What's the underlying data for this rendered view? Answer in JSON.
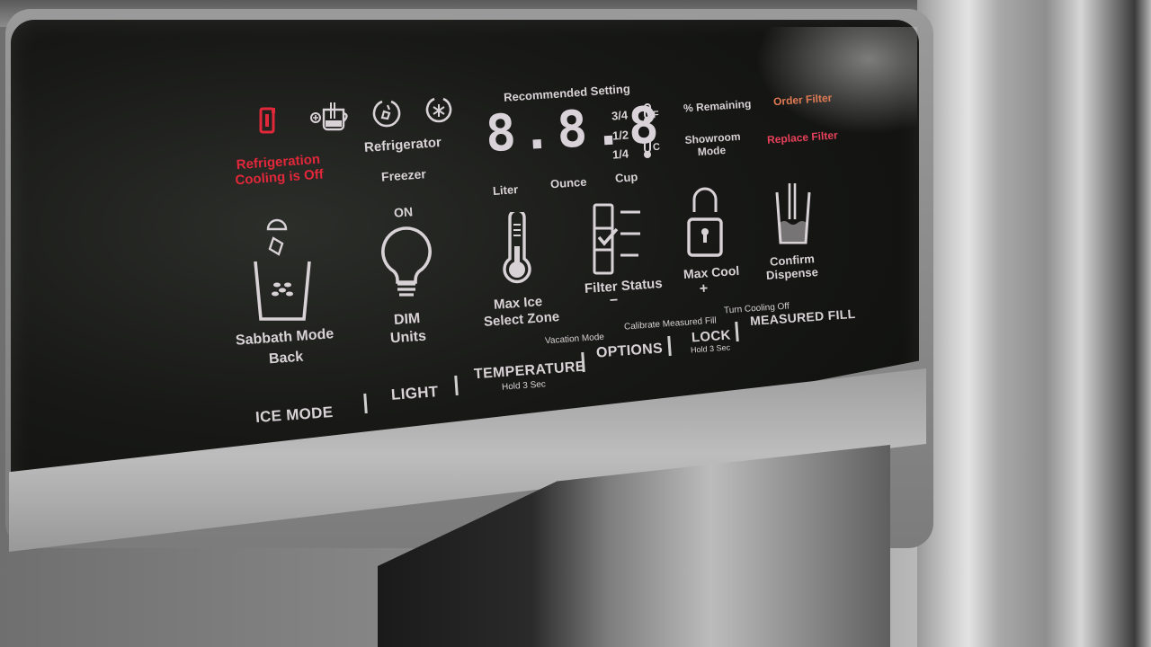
{
  "panel": {
    "status": {
      "cooling_off_label": "Refrigeration Cooling is Off",
      "refrigerator_label": "Refrigerator",
      "freezer_label": "Freezer",
      "recommended_label": "Recommended Setting",
      "display_value": "8.8.8",
      "fraction_3_4": "3/4",
      "fraction_1_2": "1/2",
      "fraction_1_4": "1/4",
      "unit_f": "F",
      "unit_c": "C",
      "liter_label": "Liter",
      "ounce_label": "Ounce",
      "cup_label": "Cup",
      "percent_remaining_label": "% Remaining",
      "showroom_mode_label": "Showroom Mode",
      "order_filter_label": "Order Filter",
      "replace_filter_label": "Replace Filter"
    },
    "features": {
      "sabbath": {
        "line1": "Sabbath Mode",
        "line2": "Back"
      },
      "light": {
        "top": "ON",
        "line1": "DIM",
        "line2": "Units"
      },
      "max_ice": {
        "line1": "Max Ice",
        "line2": "Select Zone"
      },
      "filter_status": {
        "line1": "Filter Status",
        "line2": "−"
      },
      "max_cool": {
        "line1": "Max Cool",
        "line2": "+"
      },
      "confirm": {
        "line1": "Confirm",
        "line2": "Dispense"
      }
    },
    "hold_functions": {
      "vacation_mode": "Vacation Mode",
      "calibrate_measured_fill": "Calibrate Measured Fill",
      "turn_cooling_off": "Turn Cooling Off"
    },
    "buttons": {
      "ice_mode": "ICE MODE",
      "light": "LIGHT",
      "temperature": "TEMPERATURE",
      "temperature_sub": "Hold 3 Sec",
      "options": "OPTIONS",
      "lock": "LOCK",
      "lock_sub": "Hold 3 Sec",
      "measured_fill": "MEASURED FILL"
    }
  },
  "colors": {
    "alert_red": "#e0283a",
    "order_filter": "#e07a55",
    "replace_filter": "#e8405a",
    "label": "#d8d2d6"
  }
}
